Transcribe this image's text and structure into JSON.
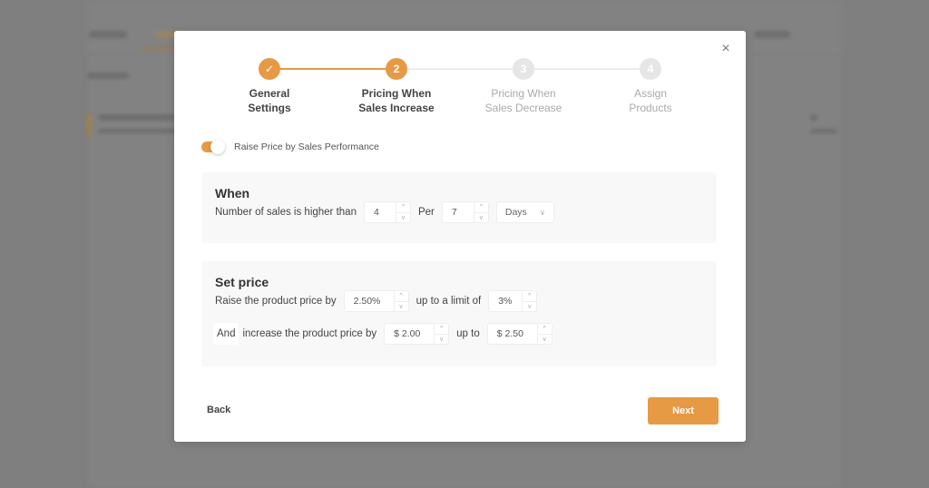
{
  "modal": {
    "steps": [
      {
        "number": "✓",
        "label_line1": "General",
        "label_line2": "Settings",
        "state": "done"
      },
      {
        "number": "2",
        "label_line1": "Pricing When",
        "label_line2": "Sales Increase",
        "state": "active"
      },
      {
        "number": "3",
        "label_line1": "Pricing When",
        "label_line2": "Sales Decrease",
        "state": "pending"
      },
      {
        "number": "4",
        "label_line1": "Assign",
        "label_line2": "Products",
        "state": "pending"
      }
    ],
    "close_icon": "×",
    "toggle": {
      "label": "Raise Price by Sales Performance",
      "on": true
    },
    "when": {
      "title": "When",
      "text": "Number of sales is higher than",
      "sales_value": "4",
      "per_label": "Per",
      "period_value": "7",
      "period_unit": "Days"
    },
    "set_price": {
      "title": "Set price",
      "row1_text": "Raise the product price by",
      "raise_percent": "2.50%",
      "limit_text": "up to a limit of",
      "limit_percent": "3%",
      "and_label": "And",
      "row2_text": "increase the product price by",
      "increase_amount": "$ 2.00",
      "upto_text": "up to",
      "upto_amount": "$ 2.50"
    },
    "spin_up": "^",
    "spin_down": "v",
    "chevron": "∨",
    "back_label": "Back",
    "next_label": "Next"
  },
  "colors": {
    "accent": "#e69a44",
    "pending": "#e6e6e6"
  }
}
